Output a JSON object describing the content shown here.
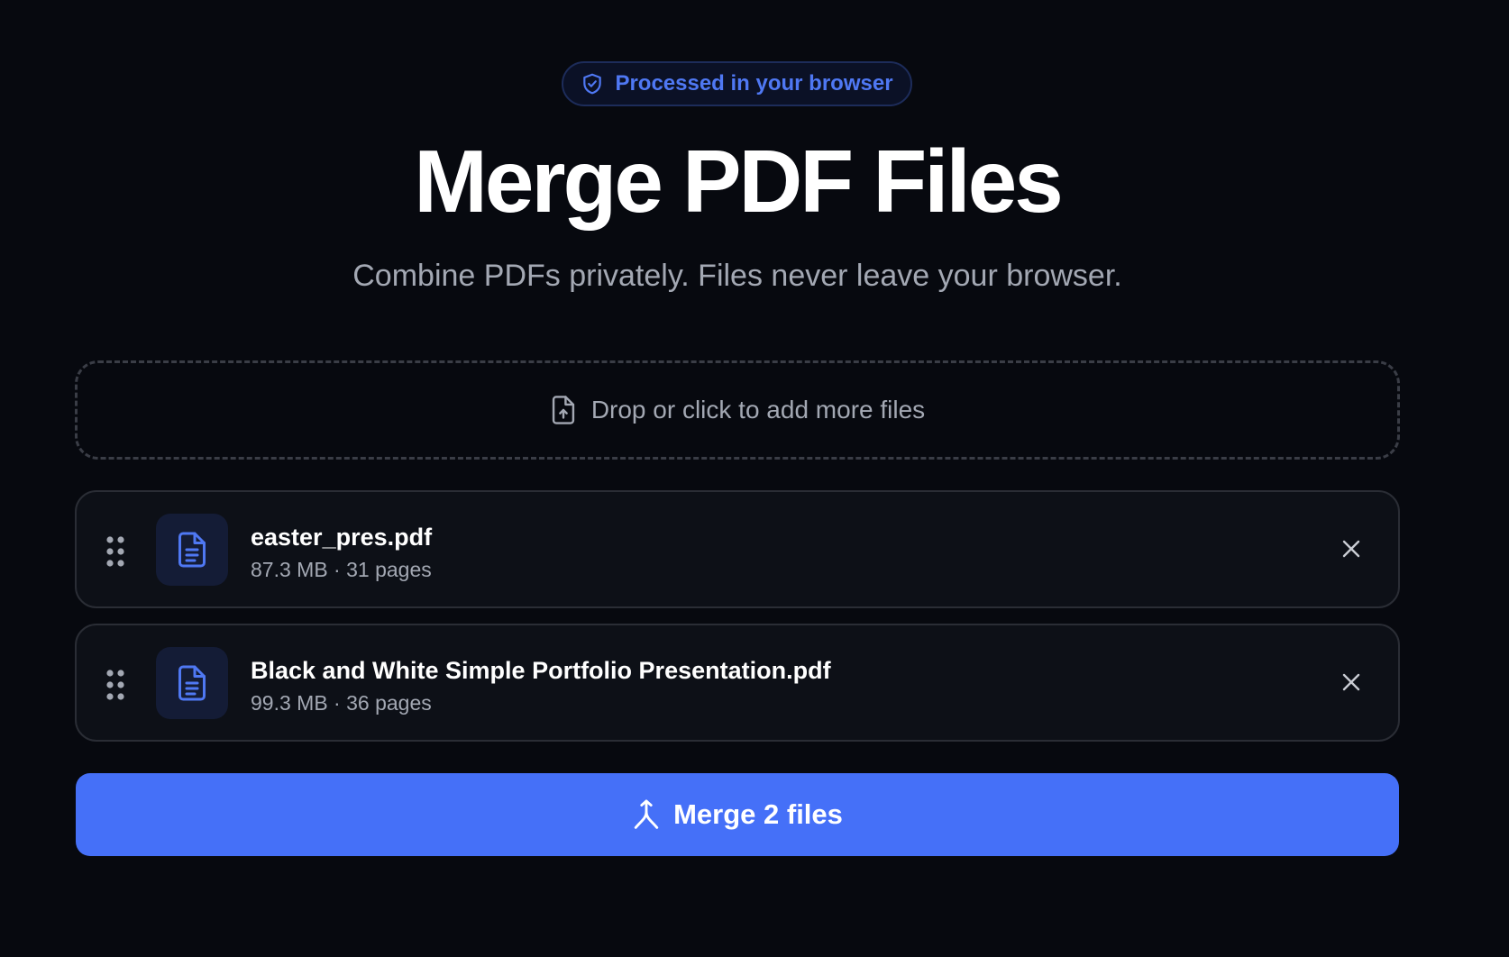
{
  "badge": {
    "text": "Processed in your browser",
    "icon": "shield-check-icon"
  },
  "header": {
    "title": "Merge PDF Files",
    "subtitle": "Combine PDFs privately. Files never leave your browser."
  },
  "dropzone": {
    "label": "Drop or click to add more files",
    "icon": "file-upload-icon"
  },
  "files": [
    {
      "name": "easter_pres.pdf",
      "meta": "87.3 MB · 31 pages"
    },
    {
      "name": "Black and White Simple Portfolio Presentation.pdf",
      "meta": "99.3 MB · 36 pages"
    }
  ],
  "merge_button": {
    "label": "Merge 2 files",
    "icon": "merge-icon"
  },
  "colors": {
    "background": "#07090f",
    "accent": "#4570f8",
    "badge_text": "#4f78f3",
    "card_background": "#0d1017",
    "muted_text": "#a3a8b3"
  }
}
